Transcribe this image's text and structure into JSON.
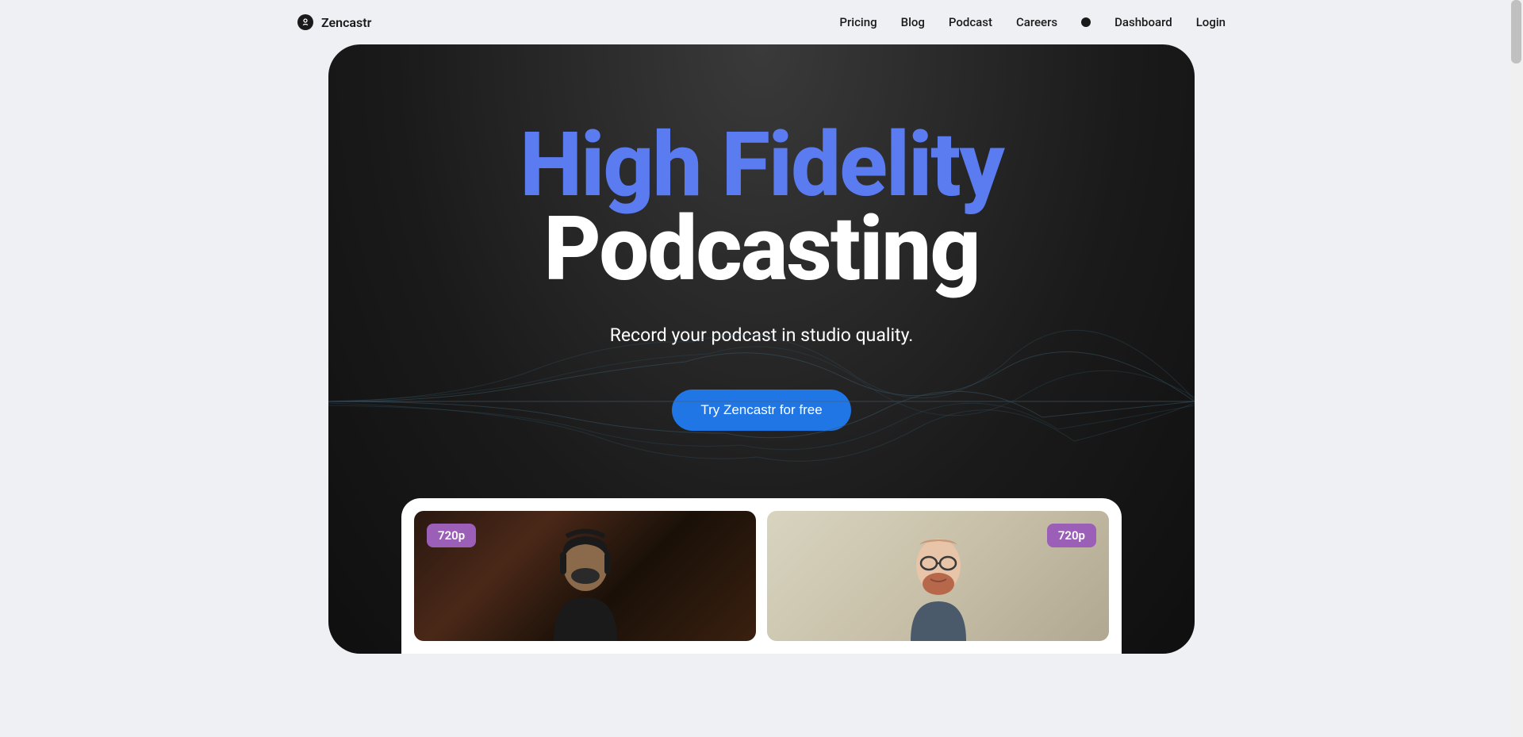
{
  "header": {
    "logo_text": "Zencastr",
    "nav_items": [
      {
        "label": "Pricing"
      },
      {
        "label": "Blog"
      },
      {
        "label": "Podcast"
      },
      {
        "label": "Careers"
      }
    ],
    "nav_right": [
      {
        "label": "Dashboard"
      },
      {
        "label": "Login"
      }
    ]
  },
  "hero": {
    "title_line1": "High Fidelity",
    "title_line2": "Podcasting",
    "subtitle": "Record your podcast in studio quality.",
    "cta_label": "Try Zencastr for free"
  },
  "video_tiles": [
    {
      "resolution": "720p",
      "position": "left"
    },
    {
      "resolution": "720p",
      "position": "right"
    }
  ]
}
